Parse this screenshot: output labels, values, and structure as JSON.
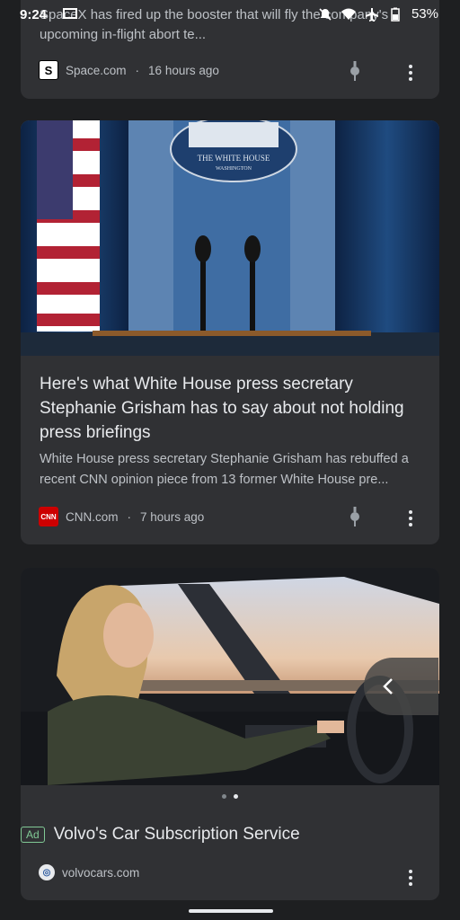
{
  "status_bar": {
    "time": "9:24",
    "battery": "53%"
  },
  "card_space": {
    "snippet": "SpaceX has fired up the booster that will fly the company's upcoming in-flight abort te...",
    "source": "Space.com",
    "favicon_letter": "S",
    "age": "16 hours ago"
  },
  "card_cnn": {
    "image_label": "THE WHITE HOUSE",
    "image_sublabel": "WASHINGTON",
    "title": "Here's what White House press secretary Stephanie Grisham has to say about not holding press briefings",
    "description": "White House press secretary Stephanie Grisham has rebuffed a recent CNN opinion piece from 13 former White House pre...",
    "source": "CNN.com",
    "favicon_text": "CNN",
    "age": "7 hours ago"
  },
  "card_ad": {
    "badge": "Ad",
    "title": "Volvo's Car Subscription Service",
    "source": "volvocars.com",
    "carousel_pages": 2,
    "carousel_active": 2
  },
  "icons": {
    "back": "chevron-left-icon",
    "pin": "pin-icon",
    "more": "more-vert-icon"
  },
  "colors": {
    "card_bg": "#303134",
    "page_bg": "#1e1f21",
    "ad_green": "#81c995"
  }
}
